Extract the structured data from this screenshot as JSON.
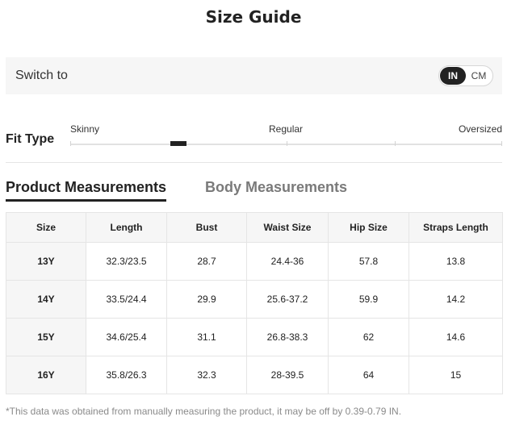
{
  "title": "Size Guide",
  "switch": {
    "label": "Switch to",
    "options": [
      "IN",
      "CM"
    ],
    "selected": "IN"
  },
  "fit": {
    "title": "Fit Type",
    "labels": [
      "Skinny",
      "Regular",
      "Oversized"
    ],
    "level": 0.25
  },
  "tabs": {
    "product": "Product Measurements",
    "body": "Body Measurements",
    "active": "Product Measurements"
  },
  "table": {
    "headers": [
      "Size",
      "Length",
      "Bust",
      "Waist Size",
      "Hip Size",
      "Straps Length"
    ],
    "rows": [
      [
        "13Y",
        "32.3/23.5",
        "28.7",
        "24.4-36",
        "57.8",
        "13.8"
      ],
      [
        "14Y",
        "33.5/24.4",
        "29.9",
        "25.6-37.2",
        "59.9",
        "14.2"
      ],
      [
        "15Y",
        "34.6/25.4",
        "31.1",
        "26.8-38.3",
        "62",
        "14.6"
      ],
      [
        "16Y",
        "35.8/26.3",
        "32.3",
        "28-39.5",
        "64",
        "15"
      ]
    ]
  },
  "footnote": "*This data was obtained from manually measuring the product, it may be off by 0.39-0.79 IN.",
  "colors": {
    "accent": "#222222",
    "panel": "#f6f6f6",
    "border": "#e5e5e5",
    "muted_text": "#7a7a7a"
  }
}
